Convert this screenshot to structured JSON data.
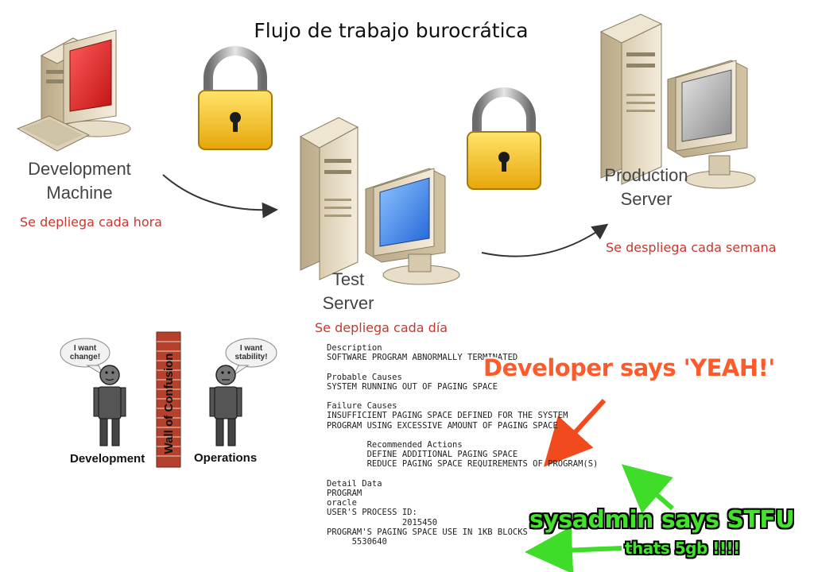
{
  "title": "Flujo de trabajo burocrática",
  "nodes": {
    "development": {
      "label_line1": "Development",
      "label_line2": "Machine",
      "frequency": "Se depliega cada hora"
    },
    "test": {
      "label_line1": "Test",
      "label_line2": "Server",
      "frequency": "Se depliega cada día"
    },
    "production": {
      "label_line1": "Production",
      "label_line2": "Server",
      "frequency": "Se despliega cada semana"
    }
  },
  "icons": [
    "computer-icon",
    "lock-icon",
    "server-icon",
    "arrow-icon"
  ],
  "wall": {
    "label": "Wall of Confusion",
    "dev_bubble_line1": "I want",
    "dev_bubble_line2": "change!",
    "ops_bubble_line1": "I want",
    "ops_bubble_line2": "stability!",
    "dev_team": "Development",
    "ops_team": "Operations"
  },
  "error_log": "Description\nSOFTWARE PROGRAM ABNORMALLY TERMINATED\n\nProbable Causes\nSYSTEM RUNNING OUT OF PAGING SPACE\n\nFailure Causes\nINSUFFICIENT PAGING SPACE DEFINED FOR THE SYSTEM\nPROGRAM USING EXCESSIVE AMOUNT OF PAGING SPACE\n\n        Recommended Actions\n        DEFINE ADDITIONAL PAGING SPACE\n        REDUCE PAGING SPACE REQUIREMENTS OF PROGRAM(S)\n\nDetail Data\nPROGRAM\noracle\nUSER'S PROCESS ID:\n               2015450\nPROGRAM'S PAGING SPACE USE IN 1KB BLOCKS\n     5530640",
  "annotations": {
    "developer": "Developer says 'YEAH!'",
    "sysadmin": "sysadmin says STFU",
    "size": "thats 5gb !!!!"
  },
  "colors": {
    "frequency_text": "#c8372d",
    "developer_callout": "#ff5a2a",
    "sysadmin_callout": "#43e22c",
    "lock_gold": "#f4c21a"
  }
}
